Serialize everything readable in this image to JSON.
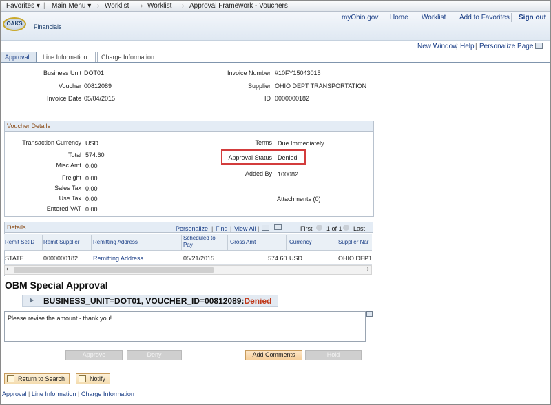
{
  "topnav": {
    "favorites": "Favorites",
    "main_menu": "Main Menu",
    "worklist1": "Worklist",
    "worklist2": "Worklist",
    "approval_framework": "Approval Framework - Vouchers"
  },
  "header": {
    "logo_text": "OAKS",
    "logo_sub": "Financials",
    "links": {
      "myohio": "myOhio.gov",
      "home": "Home",
      "worklist": "Worklist",
      "add_fav": "Add to Favorites",
      "signout": "Sign out"
    }
  },
  "pagelinks": {
    "new_window": "New Window",
    "help": "Help",
    "personalize": "Personalize Page"
  },
  "tabs": [
    "Approval",
    "Line Information",
    "Charge Information"
  ],
  "invoice": {
    "business_unit_label": "Business Unit",
    "business_unit": "DOT01",
    "voucher_label": "Voucher",
    "voucher": "00812089",
    "invoice_date_label": "Invoice Date",
    "invoice_date": "05/04/2015",
    "invoice_number_label": "Invoice Number",
    "invoice_number": "#10FY15043015",
    "supplier_label": "Supplier",
    "supplier": "OHIO DEPT TRANSPORTATION",
    "id_label": "ID",
    "id": "0000000182"
  },
  "voucher_details": {
    "title": "Voucher Details",
    "transaction_currency_label": "Transaction Currency",
    "transaction_currency": "USD",
    "total_label": "Total",
    "total": "574.60",
    "misc_amt_label": "Misc Amt",
    "misc_amt": "0.00",
    "freight_label": "Freight",
    "freight": "0.00",
    "sales_tax_label": "Sales Tax",
    "sales_tax": "0.00",
    "use_tax_label": "Use Tax",
    "use_tax": "0.00",
    "entered_vat_label": "Entered VAT",
    "entered_vat": "0.00",
    "terms_label": "Terms",
    "terms": "Due Immediately",
    "approval_status_label": "Approval Status",
    "approval_status": "Denied",
    "added_by_label": "Added By",
    "added_by": "100082",
    "attachments": "Attachments (0)"
  },
  "details": {
    "title": "Details",
    "personalize": "Personalize",
    "find": "Find",
    "view_all": "View All",
    "first": "First",
    "page_info": "1 of 1",
    "last": "Last",
    "columns": [
      "Remit SetID",
      "Remit Supplier",
      "Remitting Address",
      "Scheduled to Pay",
      "Gross Amt",
      "Currency",
      "Supplier Nar"
    ],
    "rows": [
      {
        "setid": "STATE",
        "supplier": "0000000182",
        "address": "Remitting Address",
        "scheduled": "05/21/2015",
        "gross": "574.60",
        "currency": "USD",
        "supplier_name": "OHIO DEPT"
      }
    ]
  },
  "obm": {
    "title": "OBM Special Approval",
    "criteria_prefix": "BUSINESS_UNIT=DOT01, VOUCHER_ID=00812089:",
    "criteria_status": "Denied",
    "comment": "Please revise the amount - thank you!",
    "buttons": {
      "approve": "Approve",
      "deny": "Deny",
      "add_comments": "Add Comments",
      "hold": "Hold"
    }
  },
  "actions": {
    "return": "Return to Search",
    "notify": "Notify"
  },
  "footer": {
    "approval": "Approval",
    "line_info": "Line Information",
    "charge_info": "Charge Information"
  }
}
